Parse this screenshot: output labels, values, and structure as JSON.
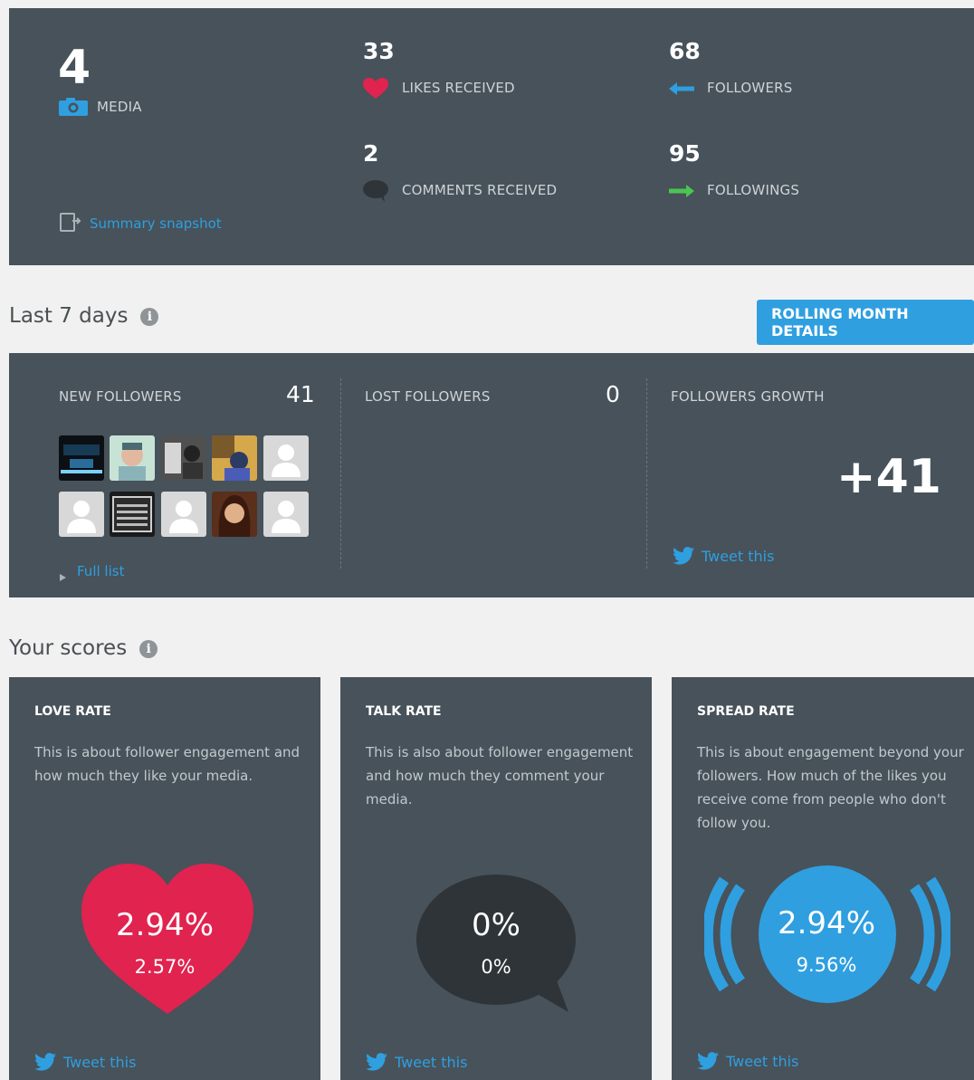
{
  "summary": {
    "media_count": "4",
    "media_label": "MEDIA",
    "likes_count": "33",
    "likes_label": "LIKES RECEIVED",
    "comments_count": "2",
    "comments_label": "COMMENTS RECEIVED",
    "followers_count": "68",
    "followers_label": "FOLLOWERS",
    "followings_count": "95",
    "followings_label": "FOLLOWINGS",
    "snapshot_link": "Summary snapshot"
  },
  "last7": {
    "title": "Last 7 days",
    "info": "i",
    "rolling_button": "ROLLING MONTH DETAILS",
    "new_followers_label": "NEW FOLLOWERS",
    "new_followers_count": "41",
    "lost_followers_label": "LOST FOLLOWERS",
    "lost_followers_count": "0",
    "growth_label": "FOLLOWERS GROWTH",
    "growth_value": "+41",
    "full_list": "Full list",
    "tweet": "Tweet this"
  },
  "scores": {
    "title": "Your scores",
    "info": "i",
    "cards": [
      {
        "title": "LOVE RATE",
        "text": "This is about follower engagement and how much they like your media.",
        "main": "2.94%",
        "sub": "2.57%",
        "tweet": "Tweet this"
      },
      {
        "title": "TALK RATE",
        "text": "This is also about follower engagement and how much they comment your media.",
        "main": "0%",
        "sub": "0%",
        "tweet": "Tweet this"
      },
      {
        "title": "SPREAD RATE",
        "text": "This is about engagement beyond your followers. How much of the likes you receive come from people who don't follow you.",
        "main": "2.94%",
        "sub": "9.56%",
        "tweet": "Tweet this"
      }
    ]
  },
  "colors": {
    "panel": "#47525a",
    "accent_blue": "#2f9fe0",
    "heart_red": "#e0234f",
    "arrow_green": "#4cc552",
    "bubble_dark": "#2e3438"
  },
  "icons": [
    "camera-icon",
    "heart-icon",
    "comment-icon",
    "arrow-left-icon",
    "arrow-right-icon",
    "snapshot-icon",
    "info-icon",
    "twitter-icon",
    "triangle-right-icon"
  ]
}
